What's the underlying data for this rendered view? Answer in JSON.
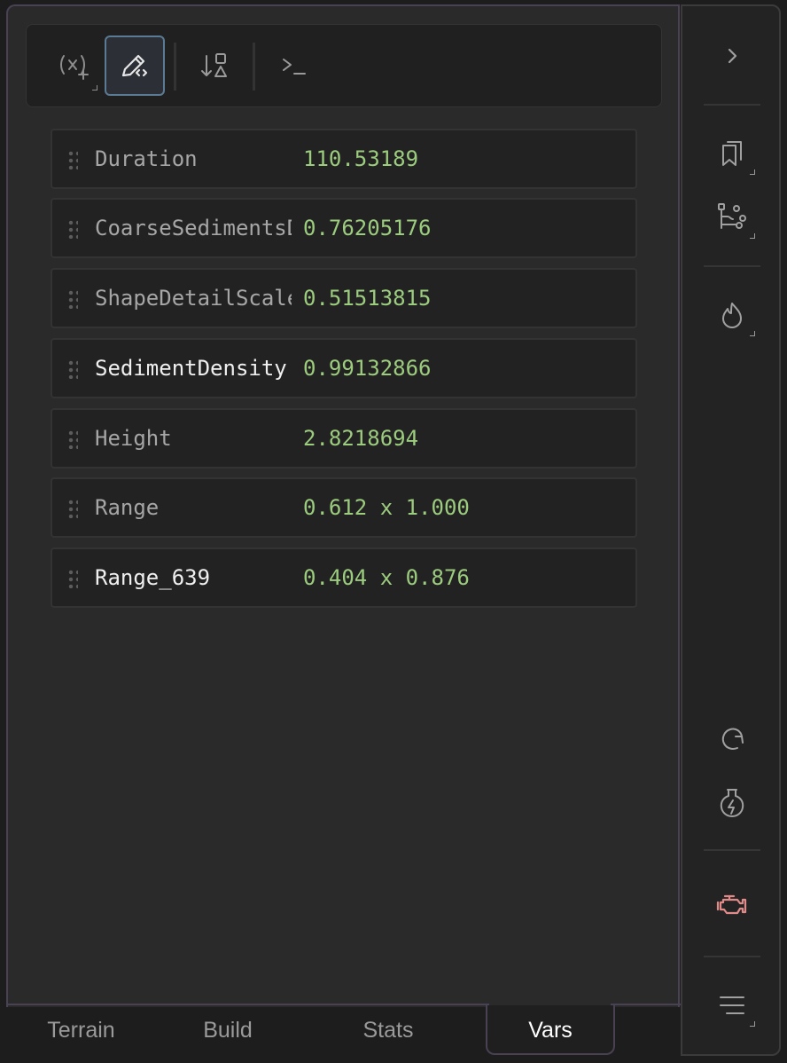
{
  "toolbar": {
    "buttons": [
      {
        "icon": "variable-add-icon",
        "active": false
      },
      {
        "icon": "pencil-code-icon",
        "active": true
      },
      {
        "icon": "sort-shapes-icon",
        "active": false
      },
      {
        "icon": "terminal-icon",
        "active": false
      }
    ]
  },
  "variables": [
    {
      "name": "Duration",
      "value": "110.53189"
    },
    {
      "name": "CoarseSedimentsD",
      "value": "0.76205176"
    },
    {
      "name": "ShapeDetailScale",
      "value": "0.51513815"
    },
    {
      "name": "SedimentDensity",
      "value": "0.99132866"
    },
    {
      "name": "Height",
      "value": "2.8218694"
    },
    {
      "name": "Range",
      "value": "0.612 x 1.000"
    },
    {
      "name": "Range_639",
      "value": "0.404 x 0.876"
    }
  ],
  "tabs": [
    {
      "label": "Terrain",
      "active": false
    },
    {
      "label": "Build",
      "active": false
    },
    {
      "label": "Stats",
      "active": false
    },
    {
      "label": "Vars",
      "active": true
    }
  ],
  "sidebar": {
    "icons": [
      "chevron-right-icon",
      "bookmarks-icon",
      "node-graph-icon",
      "flame-icon",
      "redo-icon",
      "flask-bolt-icon",
      "engine-icon",
      "menu-lines-icon"
    ],
    "engine_icon_color": "#e08a8a"
  },
  "colors": {
    "value_green": "#9ccc7e",
    "panel_border": "#4a4154",
    "active_button_border": "#5b7a93"
  }
}
